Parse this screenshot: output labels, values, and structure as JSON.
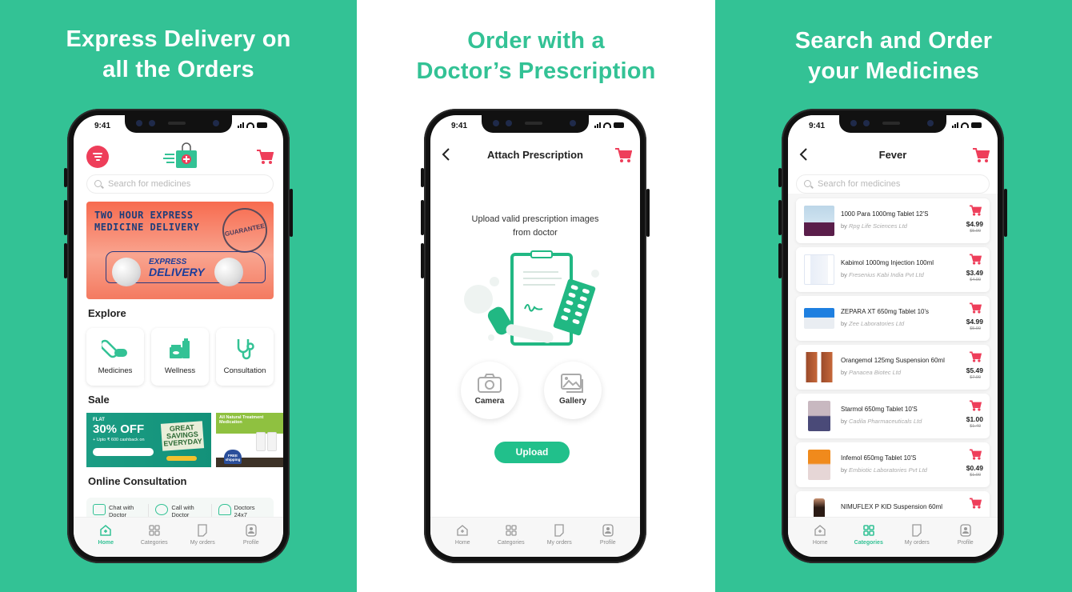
{
  "colors": {
    "brand_green": "#33c295",
    "accent_red": "#ee3e5a",
    "upload_green": "#21c08b"
  },
  "panels": [
    {
      "headline_line1": "Express Delivery on",
      "headline_line2": "all the Orders",
      "screen": {
        "status_time": "9:41",
        "search_placeholder": "Search for medicines",
        "banner": {
          "line1": "TWO HOUR EXPRESS",
          "line2": "MEDICINE DELIVERY",
          "stamp": "GUARANTEE",
          "car_line1": "EXPRESS",
          "car_line2": "DELIVERY"
        },
        "explore_title": "Explore",
        "explore_items": [
          {
            "label": "Medicines",
            "icon": "pill-capsule-icon"
          },
          {
            "label": "Wellness",
            "icon": "wellness-products-icon"
          },
          {
            "label": "Consultation",
            "icon": "stethoscope-icon"
          }
        ],
        "sale_title": "Sale",
        "sale_banners": [
          {
            "flat": "FLAT",
            "headline": "30% OFF",
            "sub": "+ Upto ₹ 600 cashback on",
            "sign": "GREAT SAVINGS EVERYDAY"
          },
          {
            "headline": "All Natural Treatment Medication",
            "badge": "FREE shipping"
          }
        ],
        "consult_title": "Online Consultation",
        "consult_items": [
          {
            "line1": "Chat with",
            "line2": "Doctor",
            "icon": "chat-icon"
          },
          {
            "line1": "Call with",
            "line2": "Doctor",
            "icon": "phone-call-icon"
          },
          {
            "line1": "Doctors",
            "line2": "24x7",
            "icon": "doctor-icon"
          }
        ],
        "tabs": [
          {
            "label": "Home",
            "active": true
          },
          {
            "label": "Categories",
            "active": false
          },
          {
            "label": "My orders",
            "active": false
          },
          {
            "label": "Profile",
            "active": false
          }
        ]
      }
    },
    {
      "headline_line1": "Order with a",
      "headline_line2": "Doctor’s Prescription",
      "screen": {
        "status_time": "9:41",
        "title": "Attach Prescription",
        "instruction_line1": "Upload valid prescription images",
        "instruction_line2": "from doctor",
        "camera_label": "Camera",
        "gallery_label": "Gallery",
        "upload_label": "Upload",
        "tabs": [
          {
            "label": "Home",
            "active": false
          },
          {
            "label": "Categories",
            "active": false
          },
          {
            "label": "My orders",
            "active": false
          },
          {
            "label": "Profile",
            "active": false
          }
        ]
      }
    },
    {
      "headline_line1": "Search and Order",
      "headline_line2": "your Medicines",
      "screen": {
        "status_time": "9:41",
        "title": "Fever",
        "search_placeholder": "Search for medicines",
        "by_prefix": "by",
        "products": [
          {
            "name": "1000 Para 1000mg Tablet 12'S",
            "maker": "Rpg Life Sciences Ltd",
            "price": "$4.99",
            "mrp": "$5.99"
          },
          {
            "name": "Kabimol 1000mg Injection 100ml",
            "maker": "Fresenius Kabi India Pvt Ltd",
            "price": "$3.49",
            "mrp": "$4.99"
          },
          {
            "name": "ZEPARA XT 650mg Tablet 10's",
            "maker": "Zee Laboratories Ltd",
            "price": "$4.99",
            "mrp": "$5.99"
          },
          {
            "name": "Orangemol 125mg Suspension 60ml",
            "maker": "Panacea Biotec Ltd",
            "price": "$5.49",
            "mrp": "$7.99"
          },
          {
            "name": "Starmol 650mg Tablet 10'S",
            "maker": "Cadila Pharmaceuticals Ltd",
            "price": "$1.00",
            "mrp": "$1.49"
          },
          {
            "name": "Infemol 650mg Tablet 10'S",
            "maker": "Embiotic Laboratories Pvt Ltd",
            "price": "$0.49",
            "mrp": "$1.00"
          },
          {
            "name": "NIMUFLEX P KID Suspension 60ml",
            "maker": "",
            "price": "",
            "mrp": ""
          }
        ],
        "tabs": [
          {
            "label": "Home",
            "active": false
          },
          {
            "label": "Categories",
            "active": true
          },
          {
            "label": "My orders",
            "active": false
          },
          {
            "label": "Profile",
            "active": false
          }
        ]
      }
    }
  ]
}
